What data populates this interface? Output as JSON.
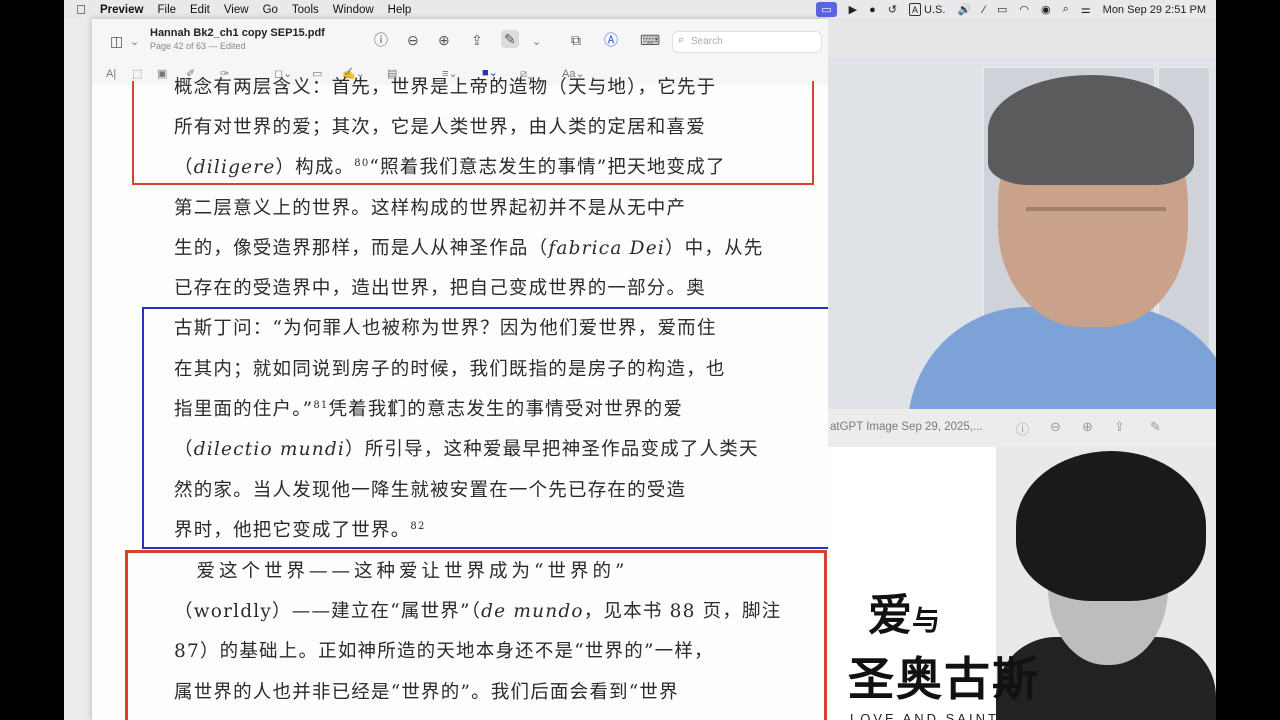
{
  "menubar": {
    "app_name": "Preview",
    "menus": [
      "File",
      "Edit",
      "View",
      "Go",
      "Tools",
      "Window",
      "Help"
    ],
    "input_source": "U.S.",
    "datetime": "Mon Sep 29  2:51 PM"
  },
  "preview_window": {
    "doc_title": "Hannah Bk2_ch1 copy SEP15.pdf",
    "doc_subtitle": "Page 42 of 63 — Edited",
    "search_placeholder": "Search",
    "format_label": "Aa"
  },
  "document": {
    "lines": [
      {
        "t": "概念有两层含义：首先，世界是上帝的造物（天与地），它先于"
      },
      {
        "t": "所有对世界的爱；其次，它是人类世界，由人类的定居和喜爱"
      },
      {
        "t1": "（",
        "it": "diligere",
        "t2": "）构成。",
        "sup": "80",
        "t3": "“照着我们意志发生的事情”把天地变成了"
      },
      {
        "t": "第二层意义上的世界。这样构成的世界起初并不是从无中产"
      },
      {
        "t1": "生的，像受造界那样，而是人从神圣作品（",
        "it": "fabrica Dei",
        "t2": "）中，从先"
      },
      {
        "t": "已存在的受造界中，造出世界，把自己变成世界的一部分。奥"
      },
      {
        "t": "古斯丁问：“为何罪人也被称为世界？因为他们爱世界，爱而住"
      },
      {
        "t": "在其内；就如同说到房子的时候，我们既指的是房子的构造，也"
      },
      {
        "t1": "指里面的住户。”",
        "sup": "81",
        "t2": "凭着我们的意志发生的事情受对世界的爱"
      },
      {
        "t1": "（",
        "it": "dilectio mundi",
        "t2": "）所引导，这种爱最早把神圣作品变成了人类天"
      },
      {
        "t": "然的家。当人发现他一降生就被安置在一个先已存在的受造"
      },
      {
        "t1": "界时，他把它变成了世界。",
        "sup": "82"
      },
      {
        "t": "　爱这个世界——这种爱让世界成为“世界的”"
      },
      {
        "t1": "（worldly）——建立在“属世界”（",
        "it": "de mundo",
        "t2": "，见本书 88 页，脚注"
      },
      {
        "t": "87）的基础上。正如神所造的天地本身还不是“世界的”一样，"
      },
      {
        "t": "属世界的人也并非已经是“世界的”。我们后面会看到“世界"
      }
    ]
  },
  "second_window": {
    "title": "atGPT Image Sep 29, 2025,..."
  },
  "book_cover": {
    "title_line1": "爱",
    "title_line1_small": "与",
    "title_line2": "圣奥古斯",
    "subtitle": "LOVE AND SAINT AUGUSTINE"
  }
}
